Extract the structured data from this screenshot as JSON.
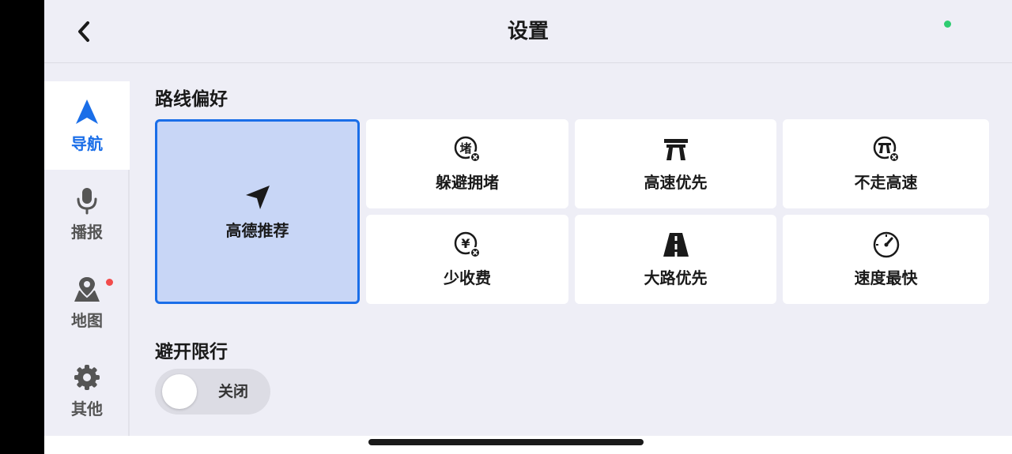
{
  "header": {
    "title": "设置",
    "back_icon": "chevron-left-icon",
    "status_dot_color": "#2ecc71"
  },
  "sidebar": {
    "items": [
      {
        "label": "导航",
        "icon": "navigation-arrow-icon",
        "active": true
      },
      {
        "label": "播报",
        "icon": "microphone-icon",
        "active": false
      },
      {
        "label": "地图",
        "icon": "map-pin-icon",
        "active": false,
        "badge_color": "#f24b4b"
      },
      {
        "label": "其他",
        "icon": "gear-icon",
        "active": false
      }
    ]
  },
  "route_preference": {
    "title": "路线偏好",
    "options": [
      {
        "label": "高德推荐",
        "icon": "paper-plane-icon",
        "selected": true
      },
      {
        "label": "躲避拥堵",
        "icon": "avoid-congestion-icon",
        "selected": false
      },
      {
        "label": "高速优先",
        "icon": "highway-icon",
        "selected": false
      },
      {
        "label": "不走高速",
        "icon": "no-highway-icon",
        "selected": false
      },
      {
        "label": "少收费",
        "icon": "less-toll-icon",
        "selected": false
      },
      {
        "label": "大路优先",
        "icon": "main-road-icon",
        "selected": false
      },
      {
        "label": "速度最快",
        "icon": "speedometer-icon",
        "selected": false
      }
    ]
  },
  "restriction": {
    "title": "避开限行",
    "toggle_label": "关闭",
    "toggle_on": false
  },
  "colors": {
    "accent": "#1a6ee8",
    "selected_bg": "#c8d6f6",
    "page_bg": "#eeeef6"
  }
}
